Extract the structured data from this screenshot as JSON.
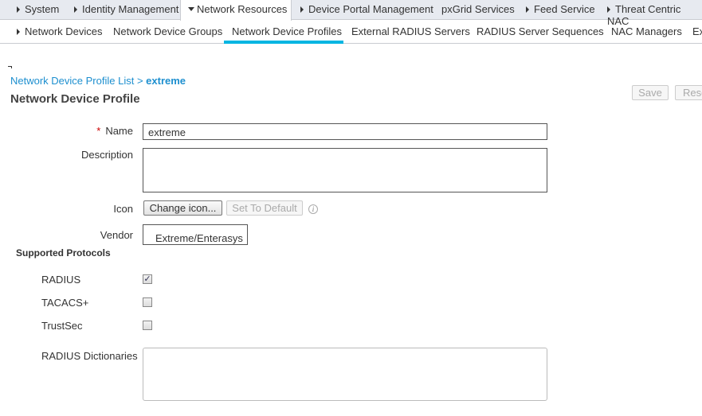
{
  "top_tabs": [
    {
      "label": "System",
      "arrow": "right"
    },
    {
      "label": "Identity Management",
      "arrow": "right"
    },
    {
      "label": "Network Resources",
      "arrow": "down",
      "active": true
    },
    {
      "label": "Device Portal Management",
      "arrow": "right"
    },
    {
      "label": "pxGrid Services",
      "arrow": "none"
    },
    {
      "label": "Feed Service",
      "arrow": "right"
    },
    {
      "label": "Threat Centric NAC",
      "arrow": "right"
    }
  ],
  "sub_tabs": [
    {
      "label": "Network Devices",
      "arrow": "right"
    },
    {
      "label": "Network Device Groups"
    },
    {
      "label": "Network Device Profiles",
      "active": true
    },
    {
      "label": "External RADIUS Servers"
    },
    {
      "label": "RADIUS Server Sequences"
    },
    {
      "label": "NAC Managers"
    },
    {
      "label": "Ex"
    }
  ],
  "accent_color": "#00b5e2",
  "breadcrumb": {
    "parent": "Network Device Profile List",
    "separator": ">",
    "current": "extreme"
  },
  "page_title": "Network Device Profile",
  "actions": {
    "save": "Save",
    "reset": "Rese"
  },
  "form": {
    "name_label": "Name",
    "required_mark": "*",
    "name_value": "extreme",
    "description_label": "Description",
    "description_value": "",
    "icon_label": "Icon",
    "change_icon": "Change icon...",
    "set_default": "Set To Default",
    "vendor_label": "Vendor",
    "vendor_value": "Extreme/Enterasys"
  },
  "protocols": {
    "heading": "Supported Protocols",
    "items": [
      {
        "label": "RADIUS",
        "checked": true
      },
      {
        "label": "TACACS+",
        "checked": false
      },
      {
        "label": "TrustSec",
        "checked": false
      }
    ]
  },
  "dictionaries_label": "RADIUS Dictionaries"
}
